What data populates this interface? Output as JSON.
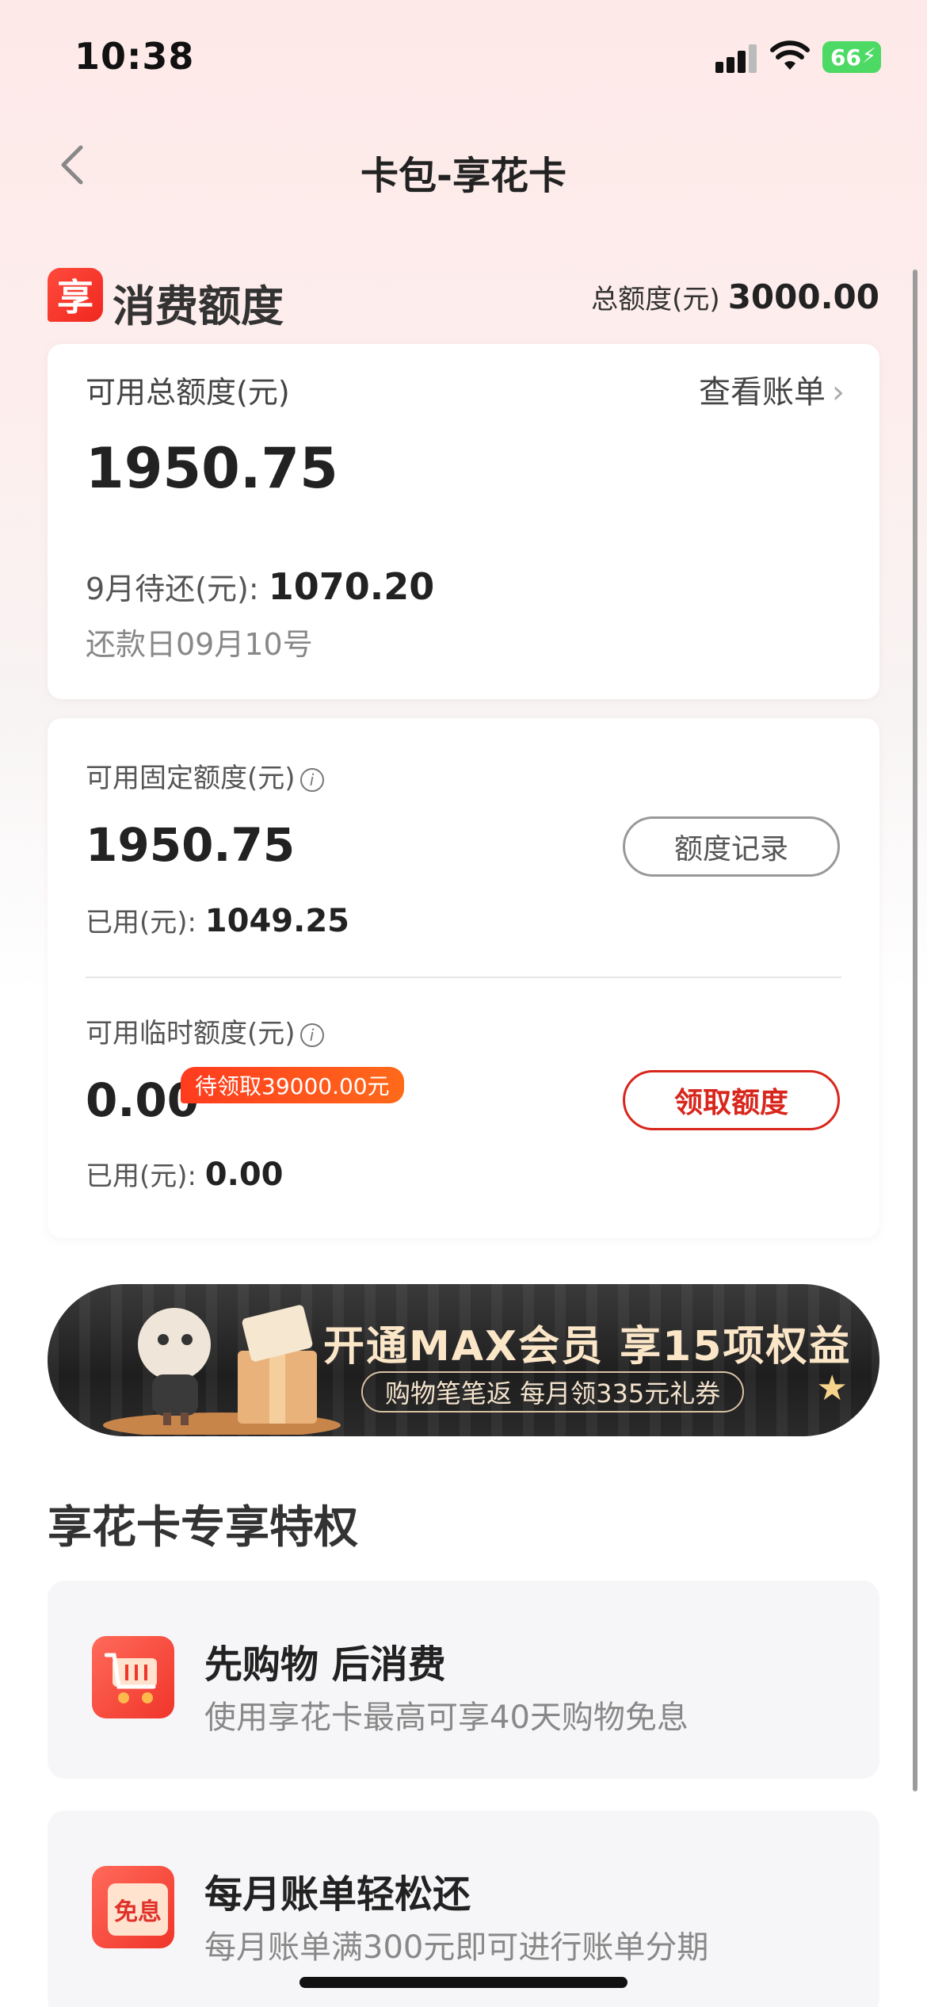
{
  "status_bar": {
    "time": "10:38",
    "battery": "66"
  },
  "nav": {
    "title": "卡包-享花卡"
  },
  "section": {
    "brand_icon": "享",
    "title": "消费额度",
    "total_label": "总额度(元)",
    "total_value": "3000.00"
  },
  "summary_card": {
    "available_label": "可用总额度(元)",
    "view_bill": "查看账单",
    "available_value": "1950.75",
    "due_label": "9月待还(元):",
    "due_value": "1070.20",
    "due_date": "还款日09月10号"
  },
  "fixed_quota": {
    "label": "可用固定额度(元)",
    "value": "1950.75",
    "button": "额度记录",
    "used_label": "已用(元):",
    "used_value": "1049.25"
  },
  "temp_quota": {
    "label": "可用临时额度(元)",
    "value": "0.00",
    "badge": "待领取39000.00元",
    "button": "领取额度",
    "used_label": "已用(元):",
    "used_value": "0.00"
  },
  "banner": {
    "title": "开通MAX会员 享15项权益",
    "subtitle": "购物笔笔返 每月领335元礼券"
  },
  "privileges": {
    "title": "享花卡专享特权",
    "items": [
      {
        "icon": "cart-icon",
        "title": "先购物 后消费",
        "desc": "使用享花卡最高可享40天购物免息"
      },
      {
        "icon": "interest-free-icon",
        "icon_text": "免息",
        "title": "每月账单轻松还",
        "desc": "每月账单满300元即可进行账单分期"
      }
    ]
  },
  "colors": {
    "accent_red": "#d8261c",
    "badge_orange": "#ff6a1a",
    "battery_green": "#4cd964"
  }
}
